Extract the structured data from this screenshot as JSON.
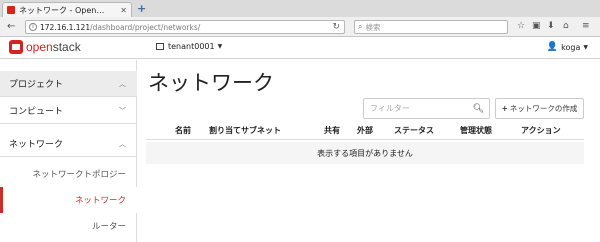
{
  "browser": {
    "tab_title": "ネットワーク - Open…",
    "url_host": "172.16.1.121",
    "url_path": "/dashboard/project/networks/",
    "search_placeholder": "検索"
  },
  "header": {
    "logo_prefix": "open",
    "logo_suffix": "stack",
    "project": "tenant0001",
    "user": "koga"
  },
  "sidebar": {
    "items": [
      {
        "label": "プロジェクト"
      },
      {
        "label": "コンピュート"
      },
      {
        "label": "ネットワーク"
      }
    ],
    "subitems": [
      {
        "label": "ネットワークトポロジー"
      },
      {
        "label": "ネットワーク"
      },
      {
        "label": "ルーター"
      }
    ]
  },
  "main": {
    "title": "ネットワーク",
    "filter_placeholder": "フィルター",
    "create_label": "ネットワークの作成",
    "columns": [
      "名前",
      "割り当てサブネット",
      "共有",
      "外部",
      "ステータス",
      "管理状態",
      "アクション"
    ],
    "empty_message": "表示する項目がありません"
  },
  "colors": {
    "brand_red": "#d52323",
    "active_red": "#c9302c"
  }
}
